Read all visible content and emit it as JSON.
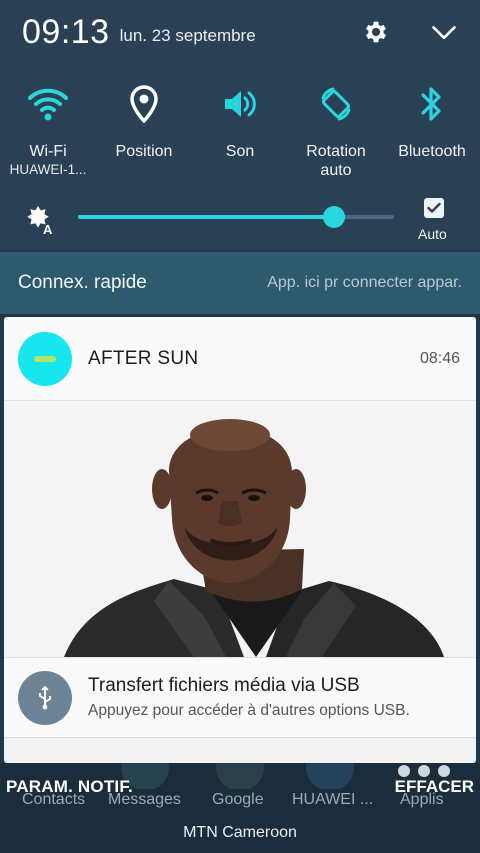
{
  "status_bar": {
    "time": "09:13",
    "date": "lun. 23 septembre"
  },
  "top_icons": {
    "settings": "gear-icon",
    "collapse": "chevron-down-icon"
  },
  "toggles": [
    {
      "id": "wifi",
      "icon": "wifi-icon",
      "label": "Wi-Fi",
      "sublabel": "HUAWEI-1..."
    },
    {
      "id": "position",
      "icon": "location-icon",
      "label": "Position"
    },
    {
      "id": "son",
      "icon": "volume-icon",
      "label": "Son"
    },
    {
      "id": "rotation",
      "icon": "rotation-icon",
      "label": "Rotation",
      "sublabel": "auto"
    },
    {
      "id": "bluetooth",
      "icon": "bluetooth-icon",
      "label": "Bluetooth"
    }
  ],
  "brightness": {
    "level": 0.81,
    "auto_label": "Auto",
    "auto_checked": true
  },
  "quick_connect": {
    "title": "Connex. rapide",
    "hint": "App. ici pr connecter appar."
  },
  "notification": {
    "title": "AFTER SUN",
    "time": "08:46"
  },
  "usb_notification": {
    "title": "Transfert fichiers média via USB",
    "subtitle": "Appuyez pour accéder à d'autres options USB."
  },
  "dock": {
    "labels": [
      "Contacts",
      "Messages",
      "Google",
      "HUAWEI ...",
      "Applis"
    ]
  },
  "actions": {
    "settings": "PARAM. NOTIF.",
    "clear": "EFFACER"
  },
  "carrier": "MTN Cameroon",
  "colors": {
    "accent": "#28d6e0",
    "panel": "#2a4055",
    "quick_connect": "#2d5a6c"
  }
}
